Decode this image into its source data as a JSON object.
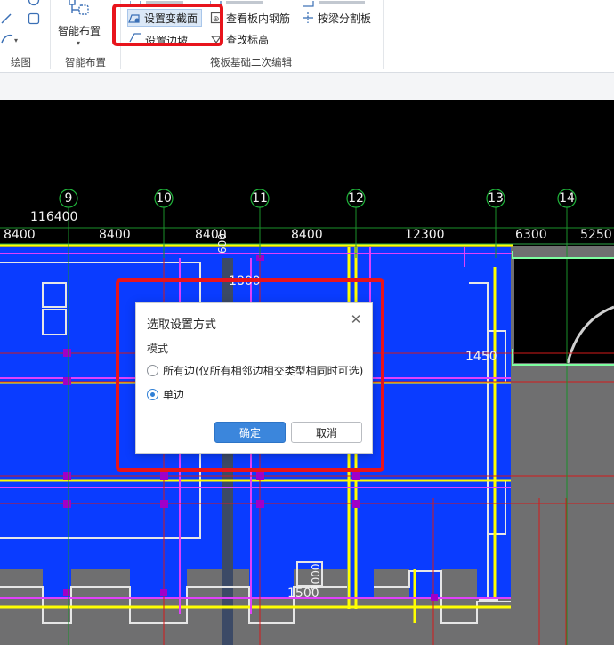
{
  "ribbon": {
    "draw": {
      "group_label": "绘图"
    },
    "smart": {
      "button_label": "智能布置",
      "group_label": "智能布置"
    },
    "edit": {
      "group_label": "筏板基础二次编辑",
      "set_section": "设置变截面",
      "set_slope_edge": "设置边坡",
      "view_rebar": "查看板内钢筋",
      "modify_elevation": "查改标高",
      "split_by_beam": "按梁分割板"
    }
  },
  "canvas": {
    "axes": [
      "9",
      "10",
      "11",
      "12",
      "13",
      "14"
    ],
    "total_dim": "116400",
    "spans": [
      "8400",
      "8400",
      "8400",
      "8400",
      "12300",
      "6300",
      "5250"
    ],
    "dims": [
      "1800",
      "1450",
      "1500"
    ],
    "vertical_dims": [
      "600",
      "1000"
    ]
  },
  "dialog": {
    "title": "选取设置方式",
    "mode_label": "模式",
    "options": [
      "所有边(仅所有相邻边相交类型相同时可选)",
      "单边"
    ],
    "selected_index": 1,
    "ok": "确定",
    "cancel": "取消"
  },
  "colors": {
    "accent": "#3b86dc",
    "highlight": "#e8141c",
    "slab_fill": "#0a3cff",
    "grid_green": "#1a8f2a",
    "yellow": "#ffff00",
    "magenta": "#e040fb"
  }
}
